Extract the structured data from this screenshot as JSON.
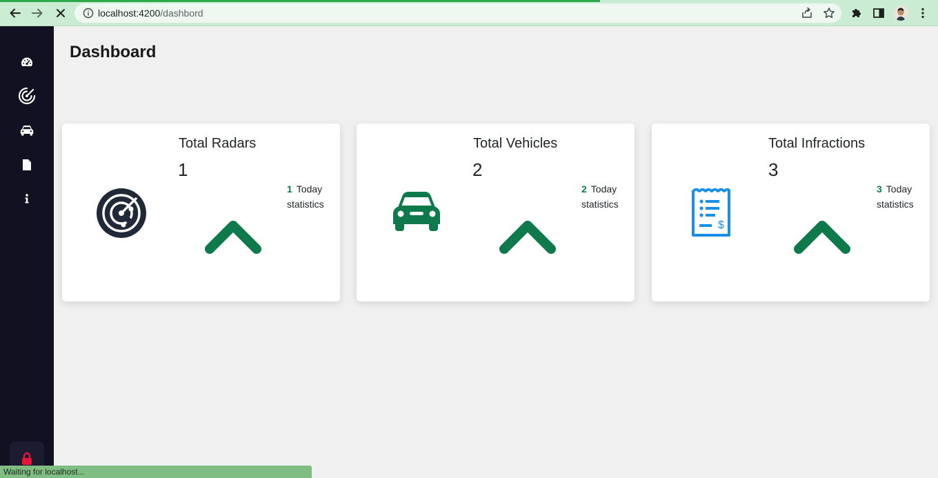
{
  "browser": {
    "url_host": "localhost:4200",
    "url_path": "/dashbord",
    "status": "Waiting for localhost..."
  },
  "sidebar": {
    "items": [
      {
        "icon": "gauge-icon"
      },
      {
        "icon": "radar-icon"
      },
      {
        "icon": "car-icon"
      },
      {
        "icon": "file-icon"
      },
      {
        "icon": "info-icon"
      }
    ],
    "bottom": {
      "icon": "lock-icon",
      "color": "#e8173a"
    }
  },
  "page": {
    "title": "Dashboard"
  },
  "cards": [
    {
      "title": "Total Radars",
      "count": "1",
      "today_count": "1",
      "today_label": "Today",
      "stat_label": "statistics",
      "icon": "radar-icon",
      "icon_color": "#1f2937"
    },
    {
      "title": "Total Vehicles",
      "count": "2",
      "today_count": "2",
      "today_label": "Today",
      "stat_label": "statistics",
      "icon": "car-icon",
      "icon_color": "#0e7a4c"
    },
    {
      "title": "Total Infractions",
      "count": "3",
      "today_count": "3",
      "today_label": "Today",
      "stat_label": "statistics",
      "icon": "receipt-icon",
      "icon_color": "#1a8fe8"
    }
  ],
  "colors": {
    "accent_green": "#0e7a4c",
    "sidebar_bg": "#111122",
    "page_bg": "#f0f0f0"
  }
}
